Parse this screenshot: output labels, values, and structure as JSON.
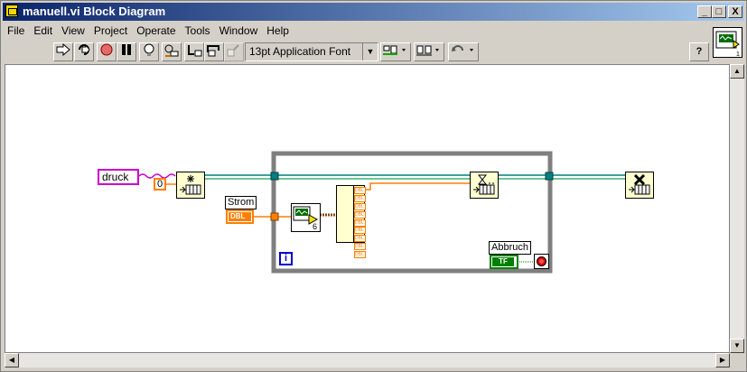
{
  "window": {
    "title": "manuell.vi Block Diagram"
  },
  "title_buttons": {
    "minimize": "_",
    "maximize": "□",
    "close": "X"
  },
  "menu": [
    {
      "label": "File"
    },
    {
      "label": "Edit"
    },
    {
      "label": "View"
    },
    {
      "label": "Project"
    },
    {
      "label": "Operate"
    },
    {
      "label": "Tools"
    },
    {
      "label": "Window"
    },
    {
      "label": "Help"
    }
  ],
  "toolbar": {
    "font": "13pt Application Font",
    "icons": [
      "run-arrow-icon",
      "run-continuous-icon",
      "abort-icon",
      "pause-icon",
      "highlight-bulb-icon",
      "retain-wire-icon",
      "step-into-icon",
      "step-over-icon",
      "step-out-icon",
      "align-icon",
      "distribute-icon",
      "reorder-icon",
      "help-icon"
    ]
  },
  "diagram": {
    "local_variable": "druck",
    "constant": "0",
    "control_label": "Strom",
    "control_type": "DBL",
    "subvi_number": "6",
    "cluster_fields": [
      "DBL",
      "DBL",
      "DBL",
      "DBL",
      "DBL",
      "DBL",
      "DBL",
      "DBL",
      "DBL"
    ],
    "stop_label": "Abbruch",
    "stop_type": "TF",
    "loop_iteration": "i",
    "colors": {
      "wire_pink": "#cc00cc",
      "wire_orange": "#ff7f00",
      "wire_green": "#008000",
      "loop_border": "#7f7f7f",
      "tunnel": "#008080"
    }
  }
}
